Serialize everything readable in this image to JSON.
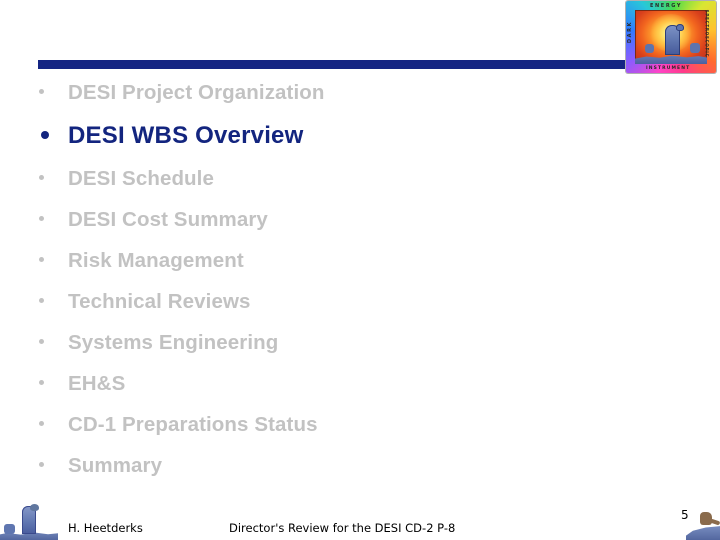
{
  "slide": {
    "kind": "outline-slide",
    "accent_color": "#13257F",
    "dim_color": "#C2C2C2",
    "rule_color": "#152583",
    "background_color": "#FFFFFF"
  },
  "logo": {
    "name": "desi-logo",
    "word_top": "ENERGY",
    "word_left": "DARK",
    "word_right": "SPECTROSCOPIC",
    "word_bottom": "INSTRUMENT"
  },
  "outline": {
    "items": [
      {
        "label": "DESI Project Organization",
        "current": false
      },
      {
        "label": "DESI WBS Overview",
        "current": true
      },
      {
        "label": "DESI Schedule",
        "current": false
      },
      {
        "label": "DESI Cost Summary",
        "current": false
      },
      {
        "label": "Risk Management",
        "current": false
      },
      {
        "label": "Technical Reviews",
        "current": false
      },
      {
        "label": "Systems Engineering",
        "current": false
      },
      {
        "label": "EH&S",
        "current": false
      },
      {
        "label": "CD-1 Preparations Status",
        "current": false
      },
      {
        "label": "Summary",
        "current": false
      }
    ]
  },
  "footer": {
    "author": "H. Heetderks",
    "center": "Director's Review for the DESI  CD-2   P-8",
    "page_number": "5"
  }
}
